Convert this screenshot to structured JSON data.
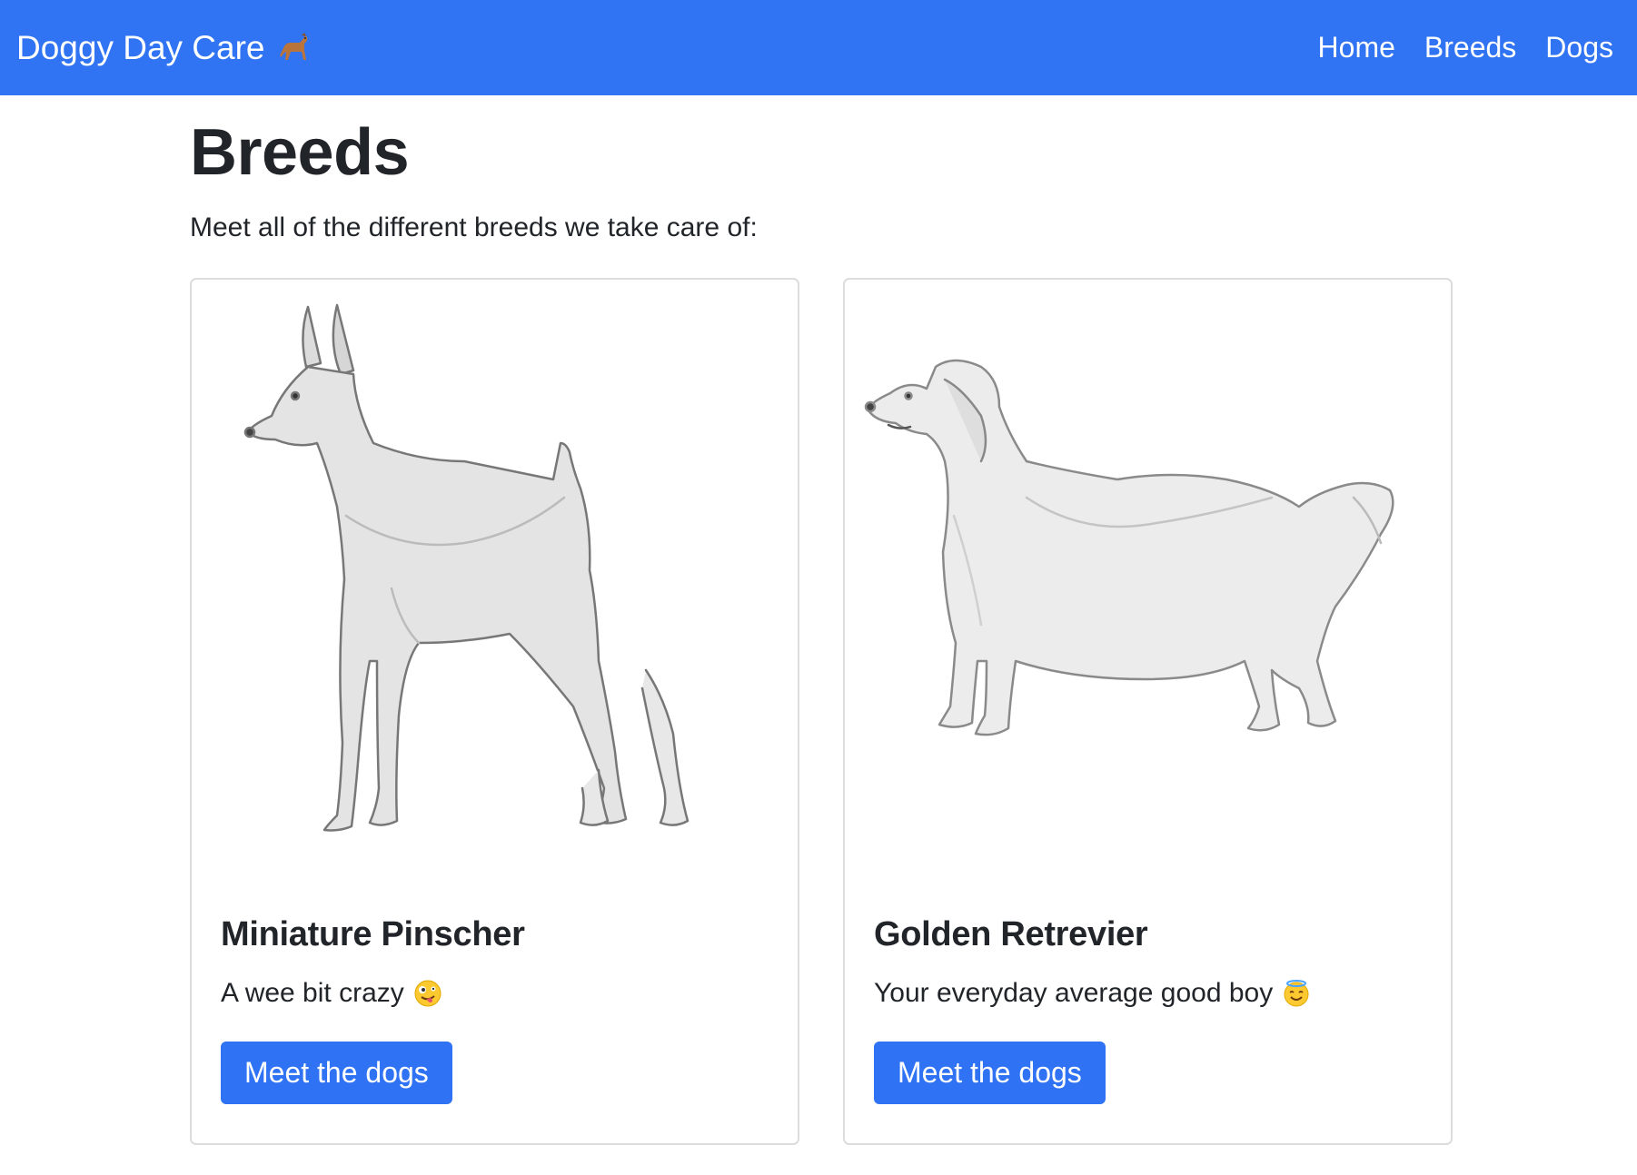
{
  "navbar": {
    "brand": "Doggy Day Care",
    "brand_icon": "dog-emoji-icon",
    "links": [
      "Home",
      "Breeds",
      "Dogs"
    ]
  },
  "main": {
    "title": "Breeds",
    "lead": "Meet all of the different breeds we take care of:",
    "cards": [
      {
        "title": "Miniature Pinscher",
        "text": "A wee bit crazy",
        "emoji": "zany-face-emoji-icon",
        "image": "miniature-pinscher-sketch",
        "button": "Meet the dogs"
      },
      {
        "title": "Golden Retrevier",
        "text": "Your everyday average good boy",
        "emoji": "halo-smile-emoji-icon",
        "image": "golden-retriever-sketch",
        "button": "Meet the dogs"
      }
    ]
  },
  "colors": {
    "navbar_bg": "#3073f3",
    "button_bg": "#2f73f4",
    "card_border": "#dcdcdc"
  }
}
